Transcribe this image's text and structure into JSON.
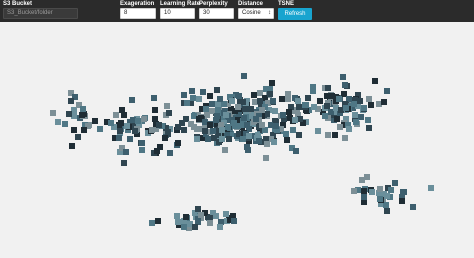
{
  "toolbar": {
    "s3_bucket": {
      "label": "S3 Bucket",
      "placeholder": "S3_Bucket/folder",
      "value": ""
    },
    "exaggeration": {
      "label": "Exageration",
      "value": "8"
    },
    "learning_rate": {
      "label": "Learning Rate",
      "value": "10"
    },
    "perplexity": {
      "label": "Perplexity",
      "value": "30"
    },
    "distance": {
      "label": "Distance",
      "value": "Cosine"
    },
    "tsne": {
      "label": "TSNE",
      "button_label": "Refresh"
    }
  },
  "colors": {
    "toolbar_bg": "#2b2b2b",
    "canvas_bg": "#f1f1f1",
    "accent": "#18a4cf",
    "thumbnail_tones": [
      "#2f4550",
      "#3d5f6e",
      "#4f7785",
      "#6a8f9b",
      "#1f2d35",
      "#7c8f96"
    ]
  }
}
